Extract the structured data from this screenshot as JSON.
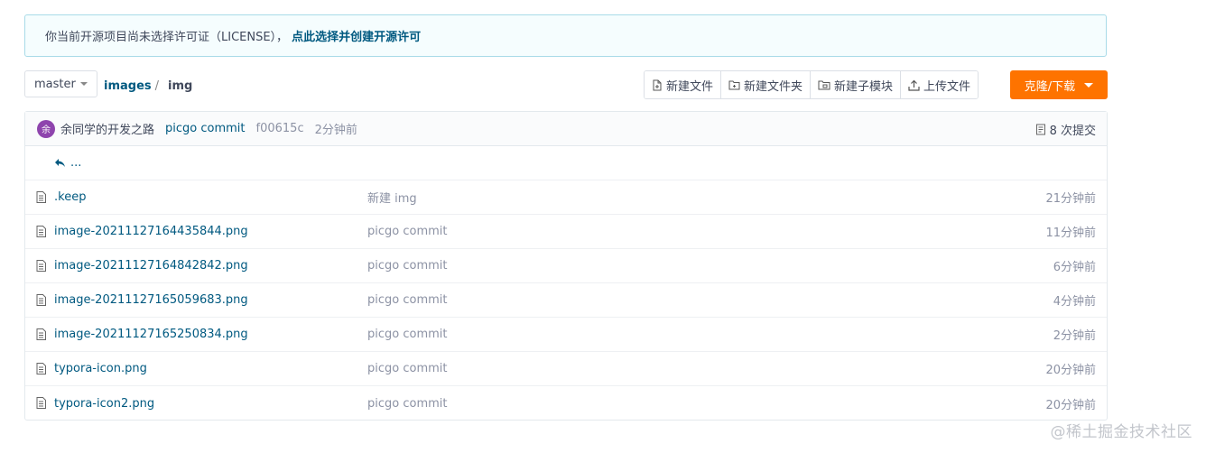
{
  "notice": {
    "text": "你当前开源项目尚未选择许可证（LICENSE），",
    "link": "点此选择并创建开源许可"
  },
  "branch": {
    "label": "master"
  },
  "breadcrumb": {
    "root": "images",
    "sep": "/",
    "current": "img"
  },
  "actions": {
    "new_file": "新建文件",
    "new_folder": "新建文件夹",
    "new_submodule": "新建子模块",
    "upload": "上传文件",
    "clone": "克隆/下载"
  },
  "commit": {
    "avatar_letter": "余",
    "avatar_color": "#8e44ad",
    "author": "余同学的开发之路",
    "message": "picgo commit",
    "sha": "f00615c",
    "time": "2分钟前",
    "count": "8 次提交"
  },
  "parent_dir": "...",
  "files": [
    {
      "name": ".keep",
      "message": "新建 img",
      "time": "21分钟前"
    },
    {
      "name": "image-20211127164435844.png",
      "message": "picgo commit",
      "time": "11分钟前"
    },
    {
      "name": "image-20211127164842842.png",
      "message": "picgo commit",
      "time": "6分钟前"
    },
    {
      "name": "image-20211127165059683.png",
      "message": "picgo commit",
      "time": "4分钟前"
    },
    {
      "name": "image-20211127165250834.png",
      "message": "picgo commit",
      "time": "2分钟前"
    },
    {
      "name": "typora-icon.png",
      "message": "picgo commit",
      "time": "20分钟前"
    },
    {
      "name": "typora-icon2.png",
      "message": "picgo commit",
      "time": "20分钟前"
    }
  ],
  "watermark": "@稀土掘金技术社区",
  "colors": {
    "accent": "#fe7300",
    "link": "#005980",
    "notice_bg": "#f5fdfe"
  }
}
